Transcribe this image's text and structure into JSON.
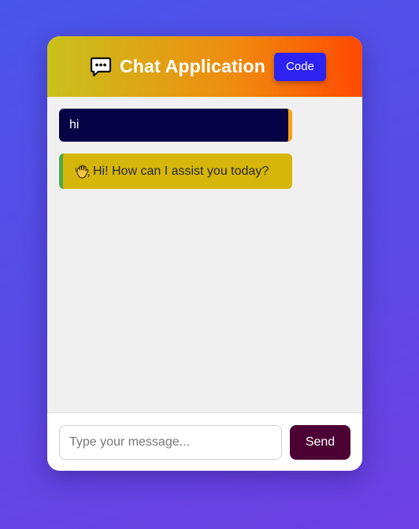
{
  "header": {
    "icon": "chat-bubble-icon",
    "title": "Chat Application",
    "code_button_label": "Code"
  },
  "messages": [
    {
      "sender": "user",
      "text": "hi"
    },
    {
      "sender": "bot",
      "icon": "waving-hand-icon",
      "text": "Hi! How can I assist you today?"
    }
  ],
  "composer": {
    "placeholder": "Type your message...",
    "value": "",
    "send_label": "Send"
  },
  "colors": {
    "header_gradient": [
      "#c9c21c",
      "#f08a0f",
      "#ff4a00"
    ],
    "code_button": "#2e22f0",
    "user_bubble": "#060245",
    "user_accent": "#f5a21a",
    "bot_bubble": "#d6b60a",
    "bot_accent": "#4ea848",
    "send_button": "#4c0033"
  }
}
